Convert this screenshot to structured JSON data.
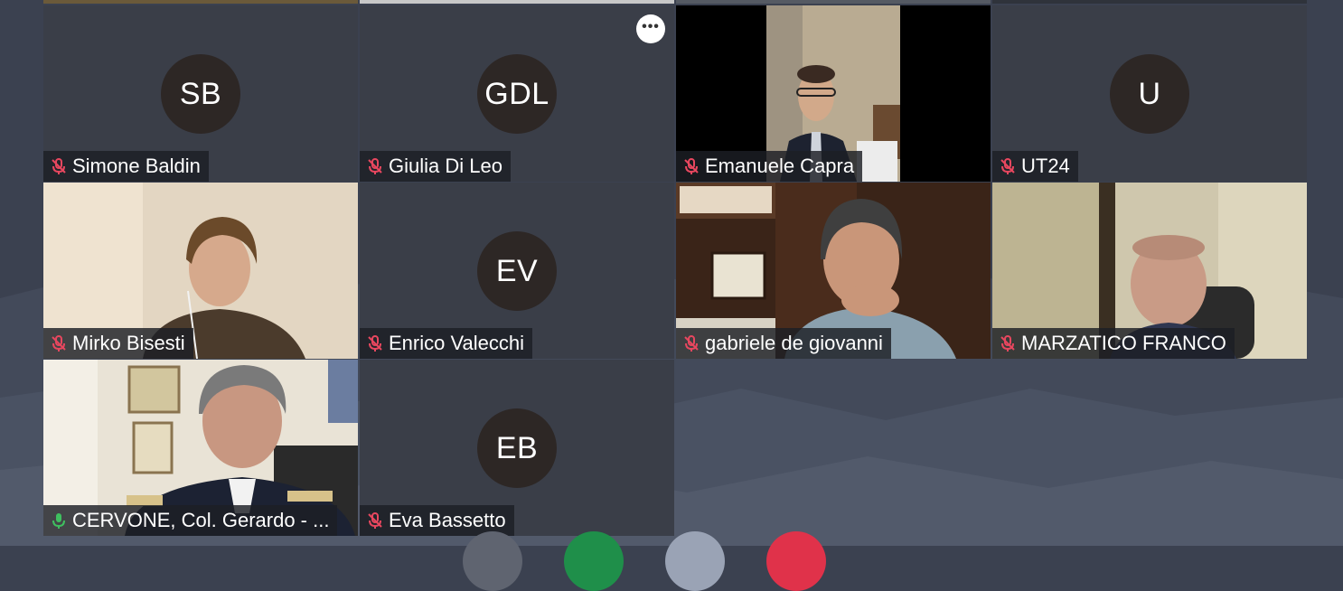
{
  "meeting": {
    "participants": [
      {
        "name": "Simone Baldin",
        "initials": "SB",
        "mic": "muted",
        "video": false
      },
      {
        "name": "Giulia Di Leo",
        "initials": "GDL",
        "mic": "muted",
        "video": false
      },
      {
        "name": "Emanuele Capra",
        "mic": "muted",
        "video": true
      },
      {
        "name": "UT24",
        "initials": "U",
        "mic": "muted",
        "video": false
      },
      {
        "name": "Mirko Bisesti",
        "mic": "muted",
        "video": true
      },
      {
        "name": "Enrico Valecchi",
        "initials": "EV",
        "mic": "muted",
        "video": false
      },
      {
        "name": "gabriele de giovanni",
        "mic": "muted",
        "video": true
      },
      {
        "name": "MARZATICO FRANCO",
        "mic": "muted",
        "video": true
      },
      {
        "name": "CERVONE, Col. Gerardo - ...",
        "mic": "active",
        "video": true
      },
      {
        "name": "Eva Bassetto",
        "initials": "EB",
        "mic": "muted",
        "video": false
      }
    ],
    "more_options_label": "•••"
  },
  "controls": [
    {
      "icon": "microphone-icon",
      "color": "#5f6470"
    },
    {
      "icon": "video-icon",
      "color": "#1f8f4a"
    },
    {
      "icon": "share-screen-icon",
      "color": "#9aa3b5"
    },
    {
      "icon": "end-call-icon",
      "color": "#e0324a"
    }
  ],
  "colors": {
    "muted_mic": "#e8475f",
    "active_mic": "#3fbf5f",
    "avatar_bg": "#2d2725",
    "tile_bg": "#3c4049",
    "background": "#3b4150"
  }
}
